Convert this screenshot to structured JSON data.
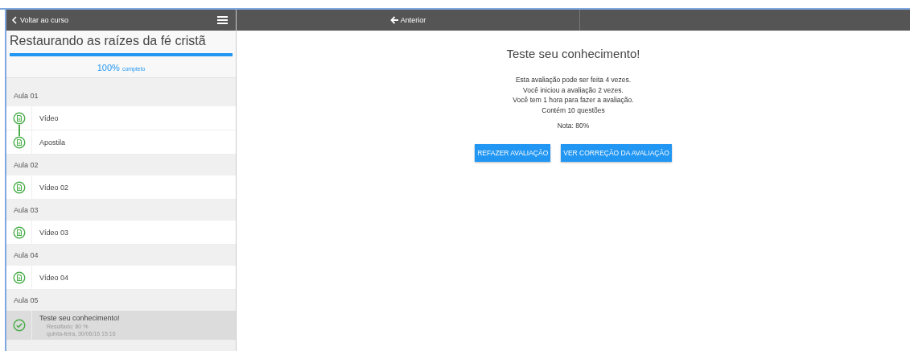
{
  "sidebar": {
    "back_link": "Voltar ao curso",
    "course_title": "Restaurando as raízes da fé cristã",
    "progress": {
      "level": 1,
      "percent": "100%",
      "label": "completo"
    },
    "lessons": [
      {
        "title": "Aula 01",
        "items": [
          {
            "kind": "document",
            "label": "Vídeo",
            "selected": false
          },
          {
            "kind": "document",
            "label": "Apostila",
            "selected": false
          }
        ]
      },
      {
        "title": "Aula 02",
        "items": [
          {
            "kind": "document",
            "label": "Vídeo 02",
            "selected": false
          }
        ]
      },
      {
        "title": "Aula 03",
        "items": [
          {
            "kind": "document",
            "label": "Vídeo 03",
            "selected": false
          }
        ]
      },
      {
        "title": "Aula 04",
        "items": [
          {
            "kind": "document",
            "label": "Vídeo 04",
            "selected": false
          }
        ]
      },
      {
        "title": "Aula 05",
        "items": [
          {
            "kind": "quiz",
            "label": "Teste seu conhecimento!",
            "result": "Resultado: 80 %",
            "date": "quinta-feira, 30/06/16 15:16",
            "selected": true
          }
        ]
      }
    ]
  },
  "nav": {
    "previous": "Anterior"
  },
  "quiz": {
    "title": "Teste seu conhecimento!",
    "info": [
      "Esta avaliação pode ser feita 4 vezes.",
      "Você iniciou a avaliação 2 vezes.",
      "Você tem 1 hora para fazer a avaliação.",
      "Contém 10 questões"
    ],
    "grade": "Nota: 80%",
    "buttons": [
      "REFAZER AVALIAÇÃO",
      "VER CORREÇÃO DA AVALIAÇÃO"
    ]
  }
}
